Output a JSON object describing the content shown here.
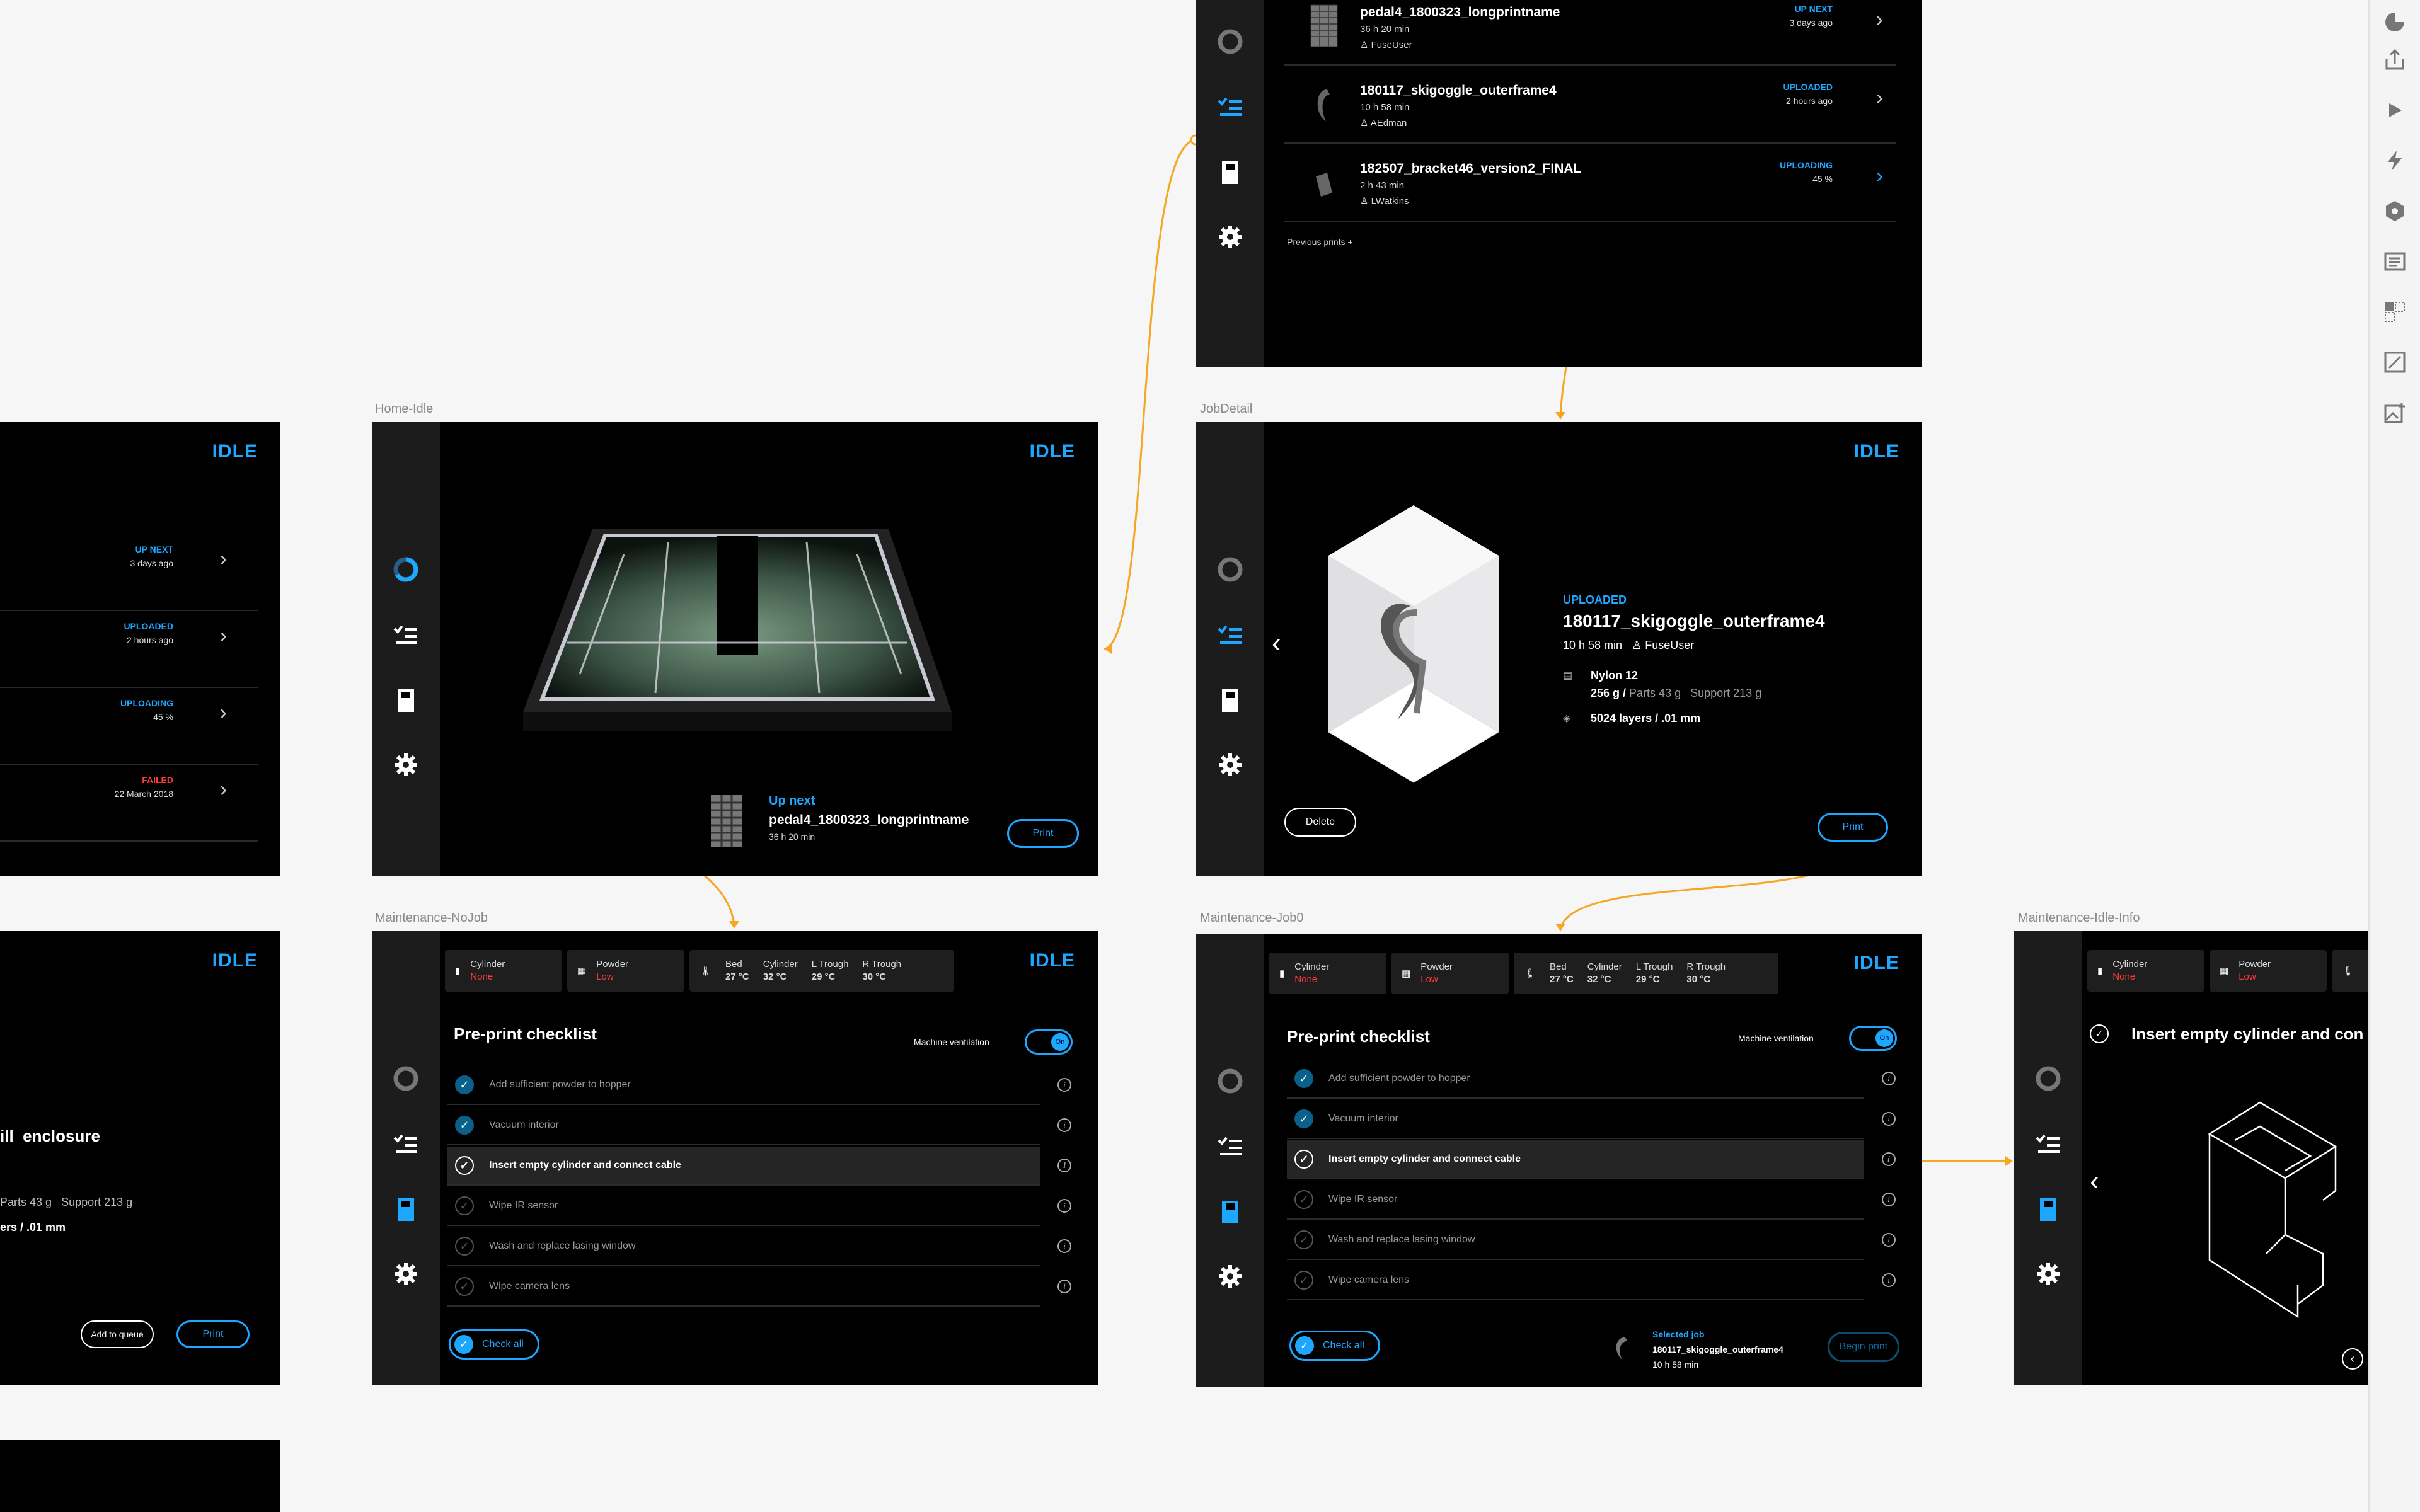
{
  "status": "IDLE",
  "labels": {
    "home_idle": "Home-Idle",
    "job_detail": "JobDetail",
    "maint_nojob": "Maintenance-NoJob",
    "maint_job0": "Maintenance-Job0",
    "maint_idle_info": "Maintenance-Idle-Info"
  },
  "queue_partial": {
    "rows": [
      {
        "status": "UP NEXT",
        "ago": "3 days ago"
      },
      {
        "status": "UPLOADED",
        "ago": "2 hours ago"
      },
      {
        "status": "UPLOADING",
        "ago": "45 %"
      },
      {
        "status": "FAILED",
        "ago": "22 March 2018"
      }
    ]
  },
  "detail_partial": {
    "name_fragment": "ill_enclosure",
    "parts": "Parts 43 g",
    "support": "Support 213 g",
    "layers": "ers / .01 mm",
    "add_queue": "Add to queue",
    "print": "Print"
  },
  "queue_top": {
    "rows": [
      {
        "name": "pedal4_1800323_longprintname",
        "duration": "36 h 20 min",
        "user": "FuseUser",
        "status": "UP NEXT",
        "ago": "3 days ago"
      },
      {
        "name": "180117_skigoggle_outerframe4",
        "duration": "10 h 58 min",
        "user": "AEdman",
        "status": "UPLOADED",
        "ago": "2 hours ago"
      },
      {
        "name": "182507_bracket46_version2_FINAL",
        "duration": "2 h 43 min",
        "user": "LWatkins",
        "status": "UPLOADING",
        "ago": "45 %"
      }
    ],
    "previous": "Previous prints  +"
  },
  "home": {
    "up_next": "Up next",
    "name": "pedal4_1800323_longprintname",
    "duration": "36 h 20 min",
    "print": "Print"
  },
  "job_detail": {
    "state": "UPLOADED",
    "name": "180117_skigoggle_outerframe4",
    "duration": "10 h 58 min",
    "user": "FuseUser",
    "material": "Nylon 12",
    "weight": "256 g /",
    "parts": "Parts 43 g",
    "support": "Support 213 g",
    "layers": "5024 layers / .01 mm",
    "delete": "Delete",
    "print": "Print"
  },
  "sensors": {
    "cylinder": {
      "label": "Cylinder",
      "value": "None"
    },
    "powder": {
      "label": "Powder",
      "value": "Low"
    },
    "bed": {
      "label": "Bed",
      "value": "27 °C"
    },
    "cyl_t": {
      "label": "Cylinder",
      "value": "32 °C"
    },
    "ltrough": {
      "label": "L Trough",
      "value": "29 °C"
    },
    "rtrough": {
      "label": "R Trough",
      "value": "30 °C"
    }
  },
  "checklist": {
    "title": "Pre-print checklist",
    "ventilation": "Machine ventilation",
    "toggle": "On",
    "items": [
      "Add sufficient powder to hopper",
      "Vacuum interior",
      "Insert empty cylinder and connect cable",
      "Wipe IR sensor",
      "Wash and replace lasing window",
      "Wipe camera lens"
    ],
    "check_all": "Check all",
    "selected_job": "Selected job",
    "selected_name": "180117_skigoggle_outerframe4",
    "selected_duration": "10 h 58 min",
    "begin_print": "Begin print"
  },
  "info_screen": {
    "title": "Insert empty cylinder and con"
  },
  "colors": {
    "accent": "#1ea7ff",
    "error": "#ff3b3b",
    "link": "#f5a623"
  }
}
